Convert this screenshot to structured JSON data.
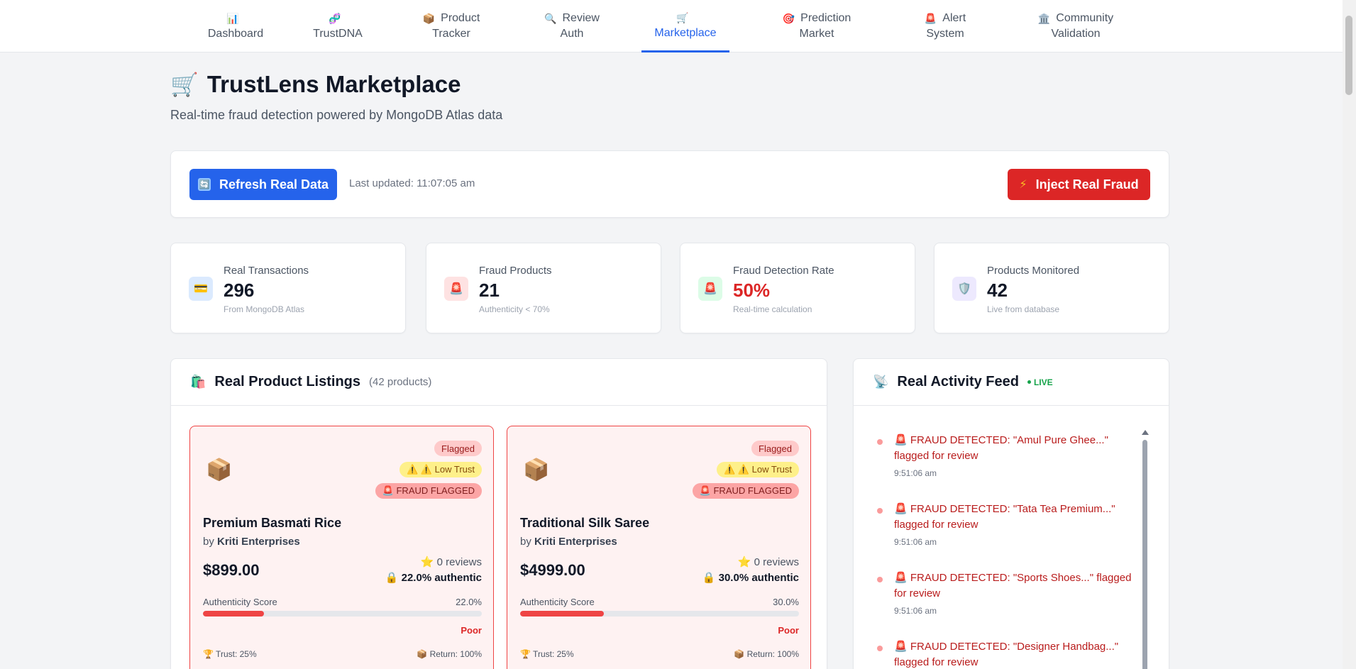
{
  "nav": [
    {
      "icon": "📊",
      "line1": "",
      "line2": "Dashboard"
    },
    {
      "icon": "🧬",
      "line1": "",
      "line2": "TrustDNA"
    },
    {
      "icon": "📦",
      "line1": "Product",
      "line2": "Tracker"
    },
    {
      "icon": "🔍",
      "line1": "Review",
      "line2": "Auth"
    },
    {
      "icon": "🛒",
      "line1": "",
      "line2": "Marketplace"
    },
    {
      "icon": "🎯",
      "line1": "Prediction",
      "line2": "Market"
    },
    {
      "icon": "🚨",
      "line1": "Alert",
      "line2": "System"
    },
    {
      "icon": "🏛️",
      "line1": "Community",
      "line2": "Validation"
    }
  ],
  "header": {
    "icon": "🛒",
    "title": "TrustLens Marketplace",
    "subtitle": "Real-time fraud detection powered by MongoDB Atlas data"
  },
  "controls": {
    "refresh_label": "Refresh Real Data",
    "refresh_icon": "🔄",
    "last_updated": "Last updated: 11:07:05 am",
    "inject_label": "Inject Real Fraud",
    "inject_icon": "⚡"
  },
  "stats": [
    {
      "label": "Real Transactions",
      "value": "296",
      "note": "From MongoDB Atlas",
      "icon": "💳",
      "icon_bg": "#dbeafe",
      "value_color": "#111827"
    },
    {
      "label": "Fraud Products",
      "value": "21",
      "note": "Authenticity < 70%",
      "icon": "🚨",
      "icon_bg": "#fee2e2",
      "value_color": "#111827"
    },
    {
      "label": "Fraud Detection Rate",
      "value": "50%",
      "note": "Real-time calculation",
      "icon": "🚨",
      "icon_bg": "#dcfce7",
      "value_color": "#dc2626"
    },
    {
      "label": "Products Monitored",
      "value": "42",
      "note": "Live from database",
      "icon": "🛡️",
      "icon_bg": "#ede9fe",
      "value_color": "#111827"
    }
  ],
  "listings": {
    "icon": "🛍️",
    "title": "Real Product Listings",
    "count": "(42 products)",
    "products": [
      {
        "tile": "📦",
        "flagged": "Flagged",
        "low_trust": "⚠️ ⚠️ Low Trust",
        "fraud": "🚨 FRAUD FLAGGED",
        "name": "Premium Basmati Rice",
        "by": "by",
        "seller": "Kriti Enterprises",
        "price": "$899.00",
        "reviews": "⭐ 0 reviews",
        "authentic": "🔒 22.0% authentic",
        "score_label": "Authenticity Score",
        "score_text": "22.0%",
        "score": 0.22,
        "rating": "Poor",
        "trust": "🏆 Trust: 25%",
        "returns": "📦 Return: 100%"
      },
      {
        "tile": "📦",
        "flagged": "Flagged",
        "low_trust": "⚠️ ⚠️ Low Trust",
        "fraud": "🚨 FRAUD FLAGGED",
        "name": "Traditional Silk Saree",
        "by": "by",
        "seller": "Kriti Enterprises",
        "price": "$4999.00",
        "reviews": "⭐ 0 reviews",
        "authentic": "🔒 30.0% authentic",
        "score_label": "Authenticity Score",
        "score_text": "30.0%",
        "score": 0.3,
        "rating": "Poor",
        "trust": "🏆 Trust: 25%",
        "returns": "📦 Return: 100%"
      }
    ]
  },
  "feed": {
    "icon": "📡",
    "title": "Real Activity Feed",
    "live": "LIVE",
    "items": [
      {
        "text": "🚨 FRAUD DETECTED: \"Amul Pure Ghee...\" flagged for review",
        "time": "9:51:06 am"
      },
      {
        "text": "🚨 FRAUD DETECTED: \"Tata Tea Premium...\" flagged for review",
        "time": "9:51:06 am"
      },
      {
        "text": "🚨 FRAUD DETECTED: \"Sports Shoes...\" flagged for review",
        "time": "9:51:06 am"
      },
      {
        "text": "🚨 FRAUD DETECTED: \"Designer Handbag...\" flagged for review",
        "time": ""
      }
    ]
  }
}
